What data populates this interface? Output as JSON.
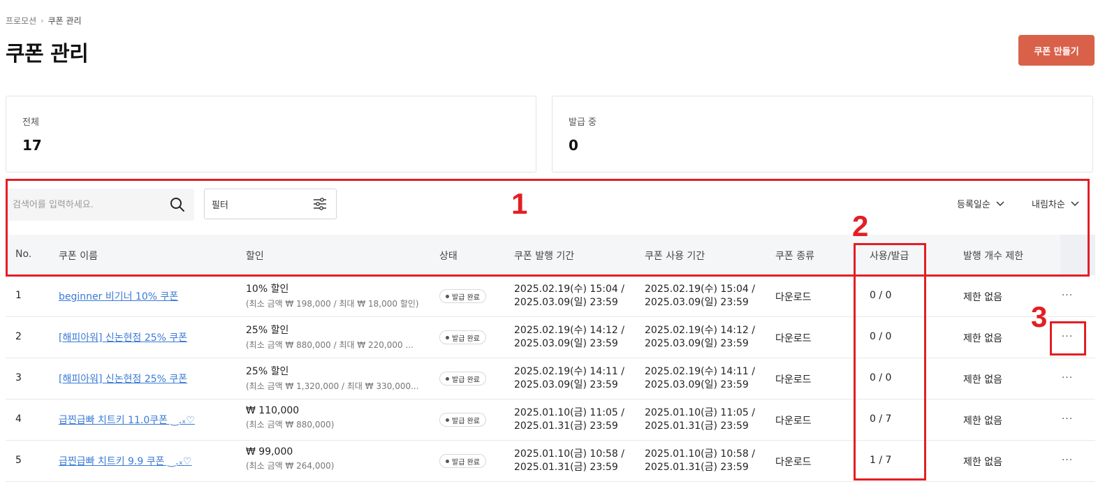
{
  "breadcrumb": {
    "parent": "프로모션",
    "separator": "›",
    "current": "쿠폰 관리"
  },
  "page_title": "쿠폰 관리",
  "create_button": "쿠폰 만들기",
  "stats": [
    {
      "label": "전체",
      "value": "17"
    },
    {
      "label": "발급 중",
      "value": "0"
    }
  ],
  "toolbar": {
    "search_placeholder": "검색어를 입력하세요.",
    "filter_label": "필터",
    "sort_field": "등록일순",
    "sort_order": "내림차순"
  },
  "table": {
    "headers": {
      "no": "No.",
      "name": "쿠폰 이름",
      "discount": "할인",
      "status": "상태",
      "issue_period": "쿠폰 발행 기간",
      "use_period": "쿠폰 사용 기간",
      "type": "쿠폰 종류",
      "ratio": "사용/발급",
      "limit": "발행 개수 제한"
    },
    "rows": [
      {
        "no": "1",
        "name": "beginner 비기너 10% 쿠폰",
        "discount_main": "10% 할인",
        "discount_sub": "(최소 금액 ₩ 198,000 / 최대 ₩ 18,000 할인)",
        "status": "발급 완료",
        "issue_line1": "2025.02.19(수) 15:04 /",
        "issue_line2": "2025.03.09(일) 23:59",
        "use_line1": "2025.02.19(수) 15:04 /",
        "use_line2": "2025.03.09(일) 23:59",
        "type": "다운로드",
        "ratio": "0 / 0",
        "limit": "제한 없음",
        "more": "···"
      },
      {
        "no": "2",
        "name": "[해피아워] 신논현점 25% 쿠폰",
        "discount_main": "25% 할인",
        "discount_sub": "(최소 금액 ₩ 880,000 / 최대 ₩ 220,000 ...",
        "status": "발급 완료",
        "issue_line1": "2025.02.19(수) 14:12 /",
        "issue_line2": "2025.03.09(일) 23:59",
        "use_line1": "2025.02.19(수) 14:12 /",
        "use_line2": "2025.03.09(일) 23:59",
        "type": "다운로드",
        "ratio": "0 / 0",
        "limit": "제한 없음",
        "more": "···"
      },
      {
        "no": "3",
        "name": "[해피아워] 신논현점 25% 쿠폰",
        "discount_main": "25% 할인",
        "discount_sub": "(최소 금액 ₩ 1,320,000 / 최대 ₩ 330,000...",
        "status": "발급 완료",
        "issue_line1": "2025.02.19(수) 14:11 /",
        "issue_line2": "2025.03.09(일) 23:59",
        "use_line1": "2025.02.19(수) 14:11 /",
        "use_line2": "2025.03.09(일) 23:59",
        "type": "다운로드",
        "ratio": "0 / 0",
        "limit": "제한 없음",
        "more": "···"
      },
      {
        "no": "4",
        "name": "급찐급빠 치트키 11.0쿠폰 ‿.ₓ♡",
        "discount_main": "₩ 110,000",
        "discount_sub": "(최소 금액 ₩ 880,000)",
        "status": "발급 완료",
        "issue_line1": "2025.01.10(금) 11:05 /",
        "issue_line2": "2025.01.31(금) 23:59",
        "use_line1": "2025.01.10(금) 11:05 /",
        "use_line2": "2025.01.31(금) 23:59",
        "type": "다운로드",
        "ratio": "0 / 7",
        "limit": "제한 없음",
        "more": "···"
      },
      {
        "no": "5",
        "name": "급찐급빠 치트키 9.9 쿠폰 ‿.ₓ♡",
        "discount_main": "₩ 99,000",
        "discount_sub": "(최소 금액 ₩ 264,000)",
        "status": "발급 완료",
        "issue_line1": "2025.01.10(금) 10:58 /",
        "issue_line2": "2025.01.31(금) 23:59",
        "use_line1": "2025.01.10(금) 10:58 /",
        "use_line2": "2025.01.31(금) 23:59",
        "type": "다운로드",
        "ratio": "1 / 7",
        "limit": "제한 없음",
        "more": "···"
      }
    ]
  },
  "annotations": {
    "label1": "1",
    "label2": "2",
    "label3": "3",
    "color": "#e31e24"
  },
  "colors": {
    "accent": "#d9614a",
    "link": "#3a7bd5"
  },
  "icons": {
    "search": "search-icon",
    "filter": "filter-sliders-icon",
    "chevron": "chevron-down-icon"
  }
}
